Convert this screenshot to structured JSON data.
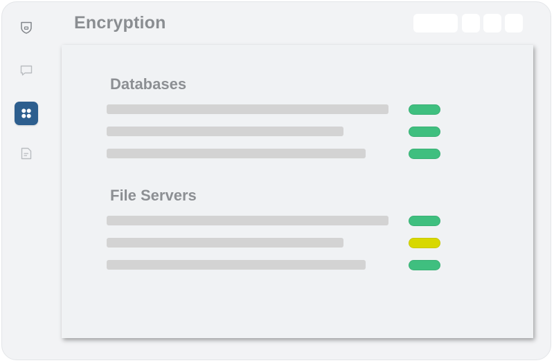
{
  "header": {
    "title": "Encryption"
  },
  "sidebar": {
    "items": [
      {
        "icon": "shield-icon",
        "active": false
      },
      {
        "icon": "chat-bubble-icon",
        "active": false
      },
      {
        "icon": "apps-grid-icon",
        "active": true
      },
      {
        "icon": "document-icon",
        "active": false
      }
    ],
    "active_color": "#2d5e8e"
  },
  "toolbar": {
    "buttons": [
      "wide-button",
      "square-button",
      "square-button",
      "square-button"
    ]
  },
  "sections": [
    {
      "title": "Databases",
      "rows": [
        {
          "status": "ok"
        },
        {
          "status": "ok"
        },
        {
          "status": "ok"
        }
      ]
    },
    {
      "title": "File Servers",
      "rows": [
        {
          "status": "ok"
        },
        {
          "status": "warning"
        },
        {
          "status": "ok"
        }
      ]
    }
  ],
  "status_colors": {
    "ok": "#3fbf7f",
    "warning": "#d8d800"
  }
}
